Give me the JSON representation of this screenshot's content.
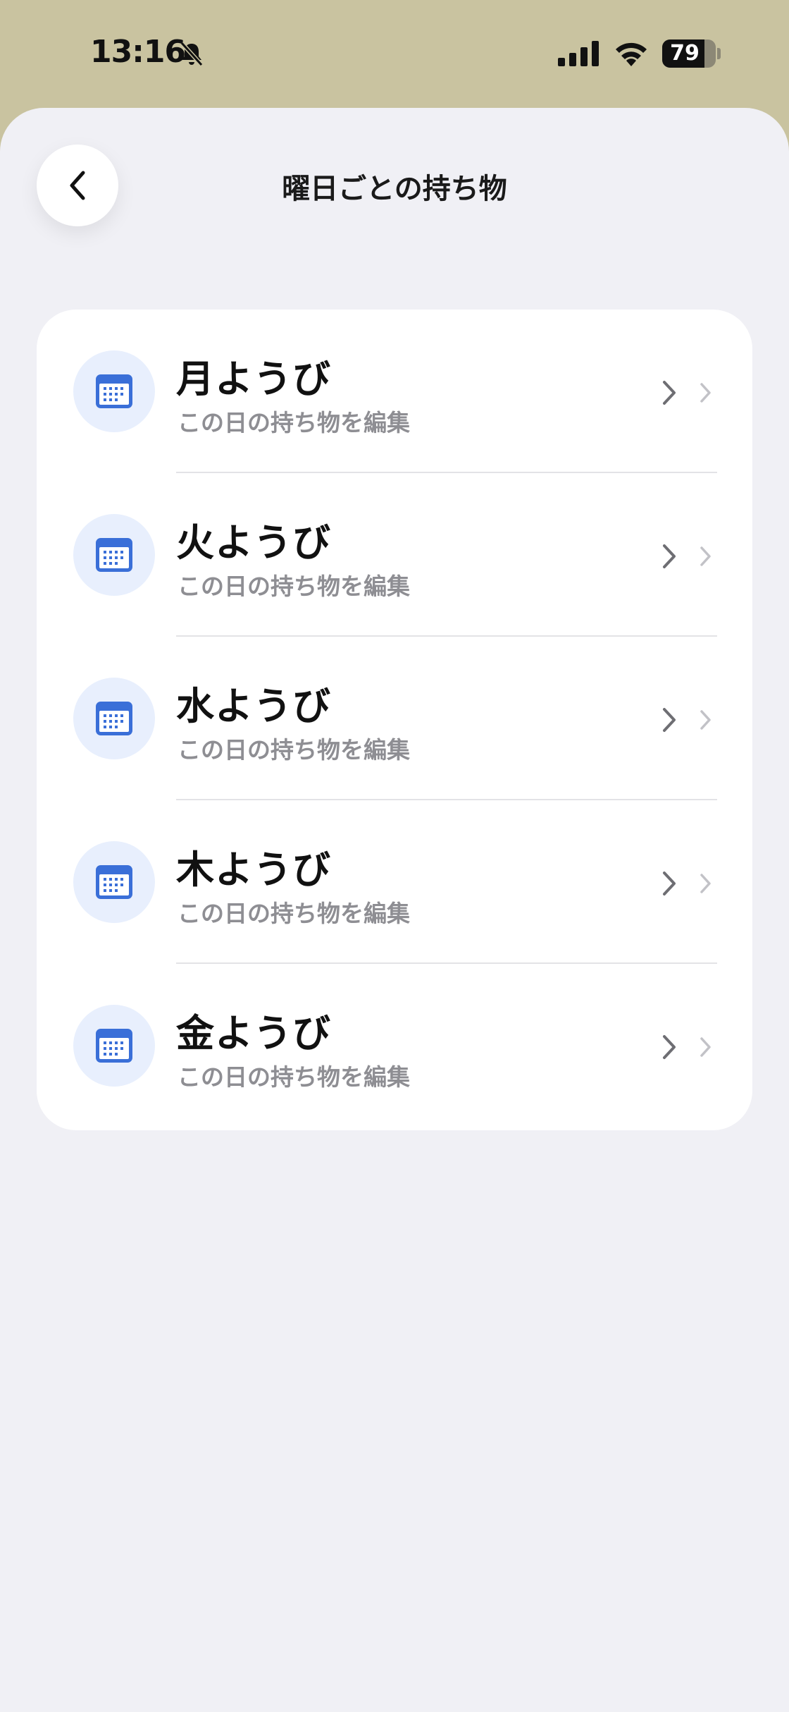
{
  "status": {
    "time": "13:16",
    "battery": "79",
    "battery_level": 0.79
  },
  "header": {
    "title": "曜日ごとの持ち物",
    "back_icon": "chevron-left-icon"
  },
  "days": [
    {
      "title": "月ようび",
      "subtitle": "この日の持ち物を編集",
      "icon": "calendar-icon"
    },
    {
      "title": "火ようび",
      "subtitle": "この日の持ち物を編集",
      "icon": "calendar-icon"
    },
    {
      "title": "水ようび",
      "subtitle": "この日の持ち物を編集",
      "icon": "calendar-icon"
    },
    {
      "title": "木ようび",
      "subtitle": "この日の持ち物を編集",
      "icon": "calendar-icon"
    },
    {
      "title": "金ようび",
      "subtitle": "この日の持ち物を編集",
      "icon": "calendar-icon"
    }
  ],
  "colors": {
    "status_bar": "#c9c3a0",
    "background": "#f0f0f5",
    "card": "#ffffff",
    "accent": "#3a6fd8",
    "icon_bg": "#e8effd",
    "subtitle": "#8e8e93"
  }
}
